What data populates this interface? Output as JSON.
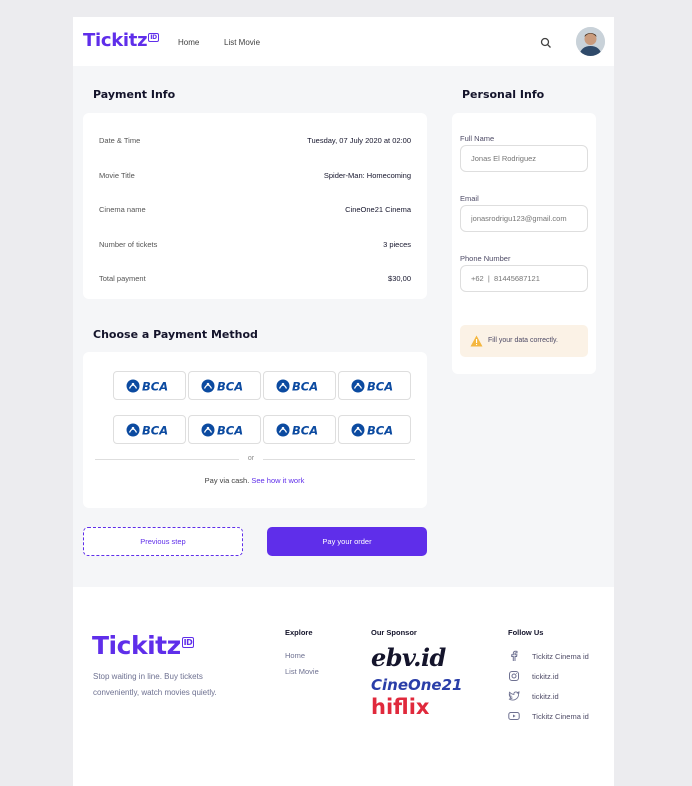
{
  "nav": {
    "brand": "Tickitz",
    "brand_tag": "ID",
    "links": [
      "Home",
      "List Movie"
    ]
  },
  "payment_info": {
    "title": "Payment Info",
    "rows": [
      {
        "label": "Date & Time",
        "value": "Tuesday, 07 July 2020 at 02:00"
      },
      {
        "label": "Movie Title",
        "value": "Spider-Man: Homecoming"
      },
      {
        "label": "Cinema name",
        "value": "CineOne21 Cinema"
      },
      {
        "label": "Number of tickets",
        "value": "3 pieces"
      },
      {
        "label": "Total payment",
        "value": "$30,00"
      }
    ]
  },
  "payment_method": {
    "title": "Choose a Payment Method",
    "options": [
      "BCA",
      "BCA",
      "BCA",
      "BCA",
      "BCA",
      "BCA",
      "BCA",
      "BCA"
    ],
    "or_label": "or",
    "cash_text": "Pay via cash.",
    "cash_link": "See how it work"
  },
  "buttons": {
    "prev": "Previous step",
    "pay": "Pay your order"
  },
  "personal_info": {
    "title": "Personal Info",
    "fields": [
      {
        "label": "Full Name",
        "placeholder": "Jonas El Rodriguez"
      },
      {
        "label": "Email",
        "placeholder": "jonasrodrigu123@gmail.com"
      },
      {
        "label": "Phone Number",
        "placeholder": "+62  |  81445687121"
      }
    ],
    "warning": "Fill your data correctly."
  },
  "footer": {
    "brand": "Tickitz",
    "brand_tag": "ID",
    "tagline": "Stop waiting in line. Buy tickets conveniently, watch movies quietly.",
    "explore_title": "Explore",
    "explore_links": [
      "Home",
      "List Movie"
    ],
    "sponsor_title": "Our Sponsor",
    "sponsors": [
      "ebv.id",
      "CineOne21",
      "hiflix"
    ],
    "follow_title": "Follow Us",
    "socials": [
      {
        "icon": "facebook-icon",
        "label": "Tickitz Cinema id"
      },
      {
        "icon": "instagram-icon",
        "label": "tickitz.id"
      },
      {
        "icon": "twitter-icon",
        "label": "tickitz.id"
      },
      {
        "icon": "youtube-icon",
        "label": "Tickitz Cinema id"
      }
    ]
  },
  "colors": {
    "accent": "#5f2eea",
    "bca_blue": "#0b4aa0",
    "warning_bg": "#fbf2e6",
    "warning_icon": "#f4b740"
  }
}
